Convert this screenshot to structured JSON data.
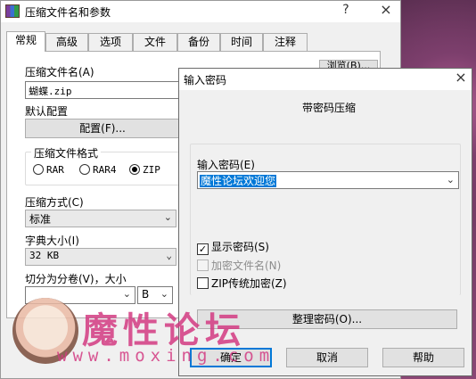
{
  "main_window": {
    "title": "压缩文件名和参数",
    "help_symbol": "?",
    "close_symbol": "×",
    "tabs": [
      "常规",
      "高级",
      "选项",
      "文件",
      "备份",
      "时间",
      "注释"
    ],
    "archive_name_label": "压缩文件名(A)",
    "archive_name_value": "蝴蝶.zip",
    "browse_button": "浏览(B)...",
    "default_profile_label": "默认配置",
    "profiles_button": "配置(F)...",
    "format_group_title": "压缩文件格式",
    "formats": [
      {
        "label": "RAR",
        "selected": false
      },
      {
        "label": "RAR4",
        "selected": false
      },
      {
        "label": "ZIP",
        "selected": true
      }
    ],
    "method_label": "压缩方式(C)",
    "method_value": "标准",
    "dict_label": "字典大小(I)",
    "dict_value": "32 KB",
    "split_label": "切分为分卷(V)，大小",
    "split_value": "",
    "split_unit": "B"
  },
  "password_dialog": {
    "title": "输入密码",
    "close_symbol": "×",
    "heading": "带密码压缩",
    "password_label": "输入密码(E)",
    "password_value": "魔性论坛欢迎您",
    "show_password": {
      "label": "显示密码(S)",
      "checked": true,
      "enabled": true
    },
    "encrypt_names": {
      "label": "加密文件名(N)",
      "checked": false,
      "enabled": false
    },
    "zip_legacy": {
      "label": "ZIP传统加密(Z)",
      "checked": false,
      "enabled": true
    },
    "organize_button": "整理密码(O)...",
    "ok_button": "确定",
    "cancel_button": "取消",
    "help_button": "帮助"
  },
  "watermark": {
    "text": "魔性论坛",
    "url": "www.moxing.com"
  },
  "colors": {
    "selection": "#0078d7",
    "watermark": "#d33b82"
  }
}
